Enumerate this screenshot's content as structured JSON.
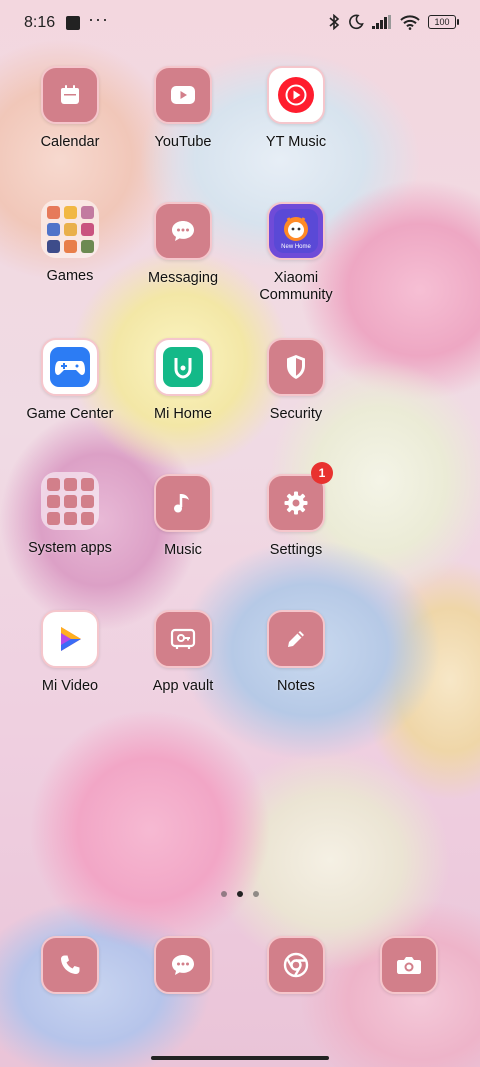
{
  "status_bar": {
    "time": "8:16",
    "more": "···",
    "battery": "100"
  },
  "apps": {
    "calendar": "Calendar",
    "youtube": "YouTube",
    "yt_music": "YT Music",
    "games": "Games",
    "messaging": "Messaging",
    "xiaomi_community": "Xiaomi Community",
    "game_center": "Game Center",
    "mi_home": "Mi Home",
    "security": "Security",
    "system_apps": "System apps",
    "music": "Music",
    "settings": "Settings",
    "settings_badge": "1",
    "mi_video": "Mi Video",
    "app_vault": "App vault",
    "notes": "Notes"
  },
  "xiaomi_badge_text": "New Home",
  "dock": {
    "icons": [
      "phone-icon",
      "messages-icon",
      "chrome-icon",
      "camera-icon"
    ]
  },
  "page_indicator": {
    "total": 3,
    "active_index": 1
  },
  "colors": {
    "tile": "#d27f8a",
    "tile_border": "#f5c6cc",
    "badge": "#e8322f"
  }
}
